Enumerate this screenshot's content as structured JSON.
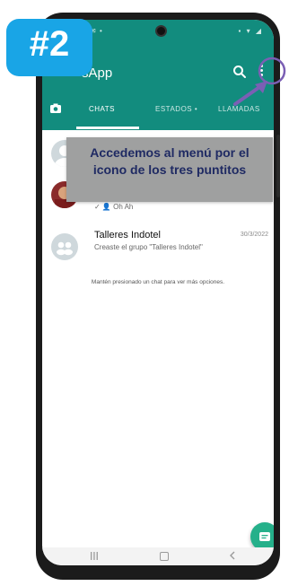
{
  "badge": {
    "label": "#2"
  },
  "status_bar": {
    "left": "▪ ✉ •",
    "right": "▪ ▾ ◢"
  },
  "appbar": {
    "title": "sApp",
    "tabs": [
      {
        "label": "CHATS"
      },
      {
        "label": "ESTADOS •"
      },
      {
        "label": "LLAMADAS"
      }
    ]
  },
  "chats": [
    {
      "name": "",
      "preview": "",
      "date": ""
    },
    {
      "name": "",
      "preview": "✓ 👤 Oh Ah",
      "date": ""
    },
    {
      "name": "Talleres Indotel",
      "preview": "Creaste el grupo \"Talleres Indotel\"",
      "date": "30/3/2022"
    }
  ],
  "hint": "Mantén presionado un chat para ver más opciones.",
  "callout": {
    "text": "Accedemos al menú por el icono de los tres puntitos"
  },
  "colors": {
    "whatsapp_green": "#128c7e",
    "fab": "#25b08a",
    "badge_blue": "#19a5e6",
    "annotation_purple": "#7b5fb4",
    "callout_text": "#1f2a63"
  }
}
